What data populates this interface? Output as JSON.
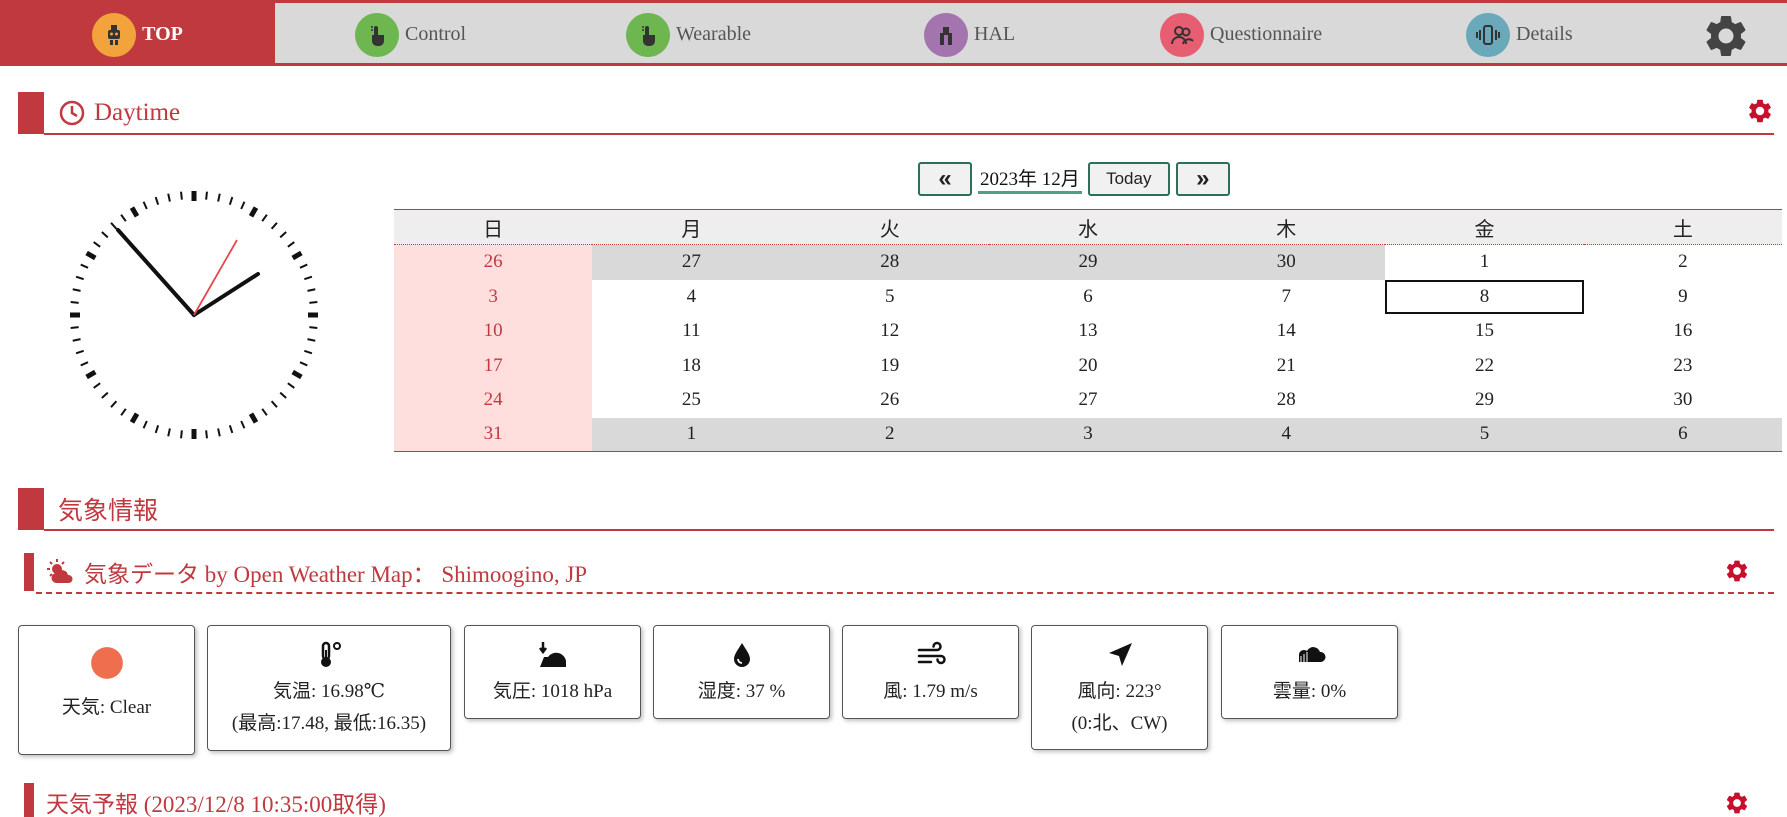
{
  "nav": {
    "tabs": [
      {
        "label": "TOP",
        "icon": "robot-icon",
        "color": "#f3a33c"
      },
      {
        "label": "Control",
        "icon": "touch-hand-icon",
        "color": "#6db650"
      },
      {
        "label": "Wearable",
        "icon": "touch-hand-icon",
        "color": "#6db650"
      },
      {
        "label": "HAL",
        "icon": "hal-icon",
        "color": "#a374ad"
      },
      {
        "label": "Questionnaire",
        "icon": "people-icon",
        "color": "#e75e72"
      },
      {
        "label": "Details",
        "icon": "phone-vibrate-icon",
        "color": "#6aa9b9"
      }
    ],
    "accent": "#c0393f"
  },
  "daytime": {
    "title": "Daytime"
  },
  "calendar": {
    "prev_label": "«",
    "next_label": "»",
    "month_label": "2023年 12月",
    "today_label": "Today",
    "weekdays": [
      "日",
      "月",
      "火",
      "水",
      "木",
      "金",
      "土"
    ],
    "weeks": [
      [
        "26",
        "27",
        "28",
        "29",
        "30",
        "1",
        "2"
      ],
      [
        "3",
        "4",
        "5",
        "6",
        "7",
        "8",
        "9"
      ],
      [
        "10",
        "11",
        "12",
        "13",
        "14",
        "15",
        "16"
      ],
      [
        "17",
        "18",
        "19",
        "20",
        "21",
        "22",
        "23"
      ],
      [
        "24",
        "25",
        "26",
        "27",
        "28",
        "29",
        "30"
      ],
      [
        "31",
        "1",
        "2",
        "3",
        "4",
        "5",
        "6"
      ]
    ],
    "selected_day": "8"
  },
  "weather_section": {
    "title": "気象情報"
  },
  "weather_data": {
    "title": "気象データ by Open Weather Map： Shimoogino, JP",
    "cards": [
      {
        "icon": "sun-dot-icon",
        "lines": [
          "天気: Clear"
        ]
      },
      {
        "icon": "thermometer-icon",
        "lines": [
          "気温: 16.98℃",
          "(最高:17.48, 最低:16.35)"
        ]
      },
      {
        "icon": "pressure-icon",
        "lines": [
          "気圧: 1018 hPa"
        ]
      },
      {
        "icon": "droplet-icon",
        "lines": [
          "湿度: 37 %"
        ]
      },
      {
        "icon": "wind-icon",
        "lines": [
          "風: 1.79 m/s"
        ]
      },
      {
        "icon": "location-arrow-icon",
        "lines": [
          "風向: 223°",
          "(0:北、CW)"
        ]
      },
      {
        "icon": "cloud-icon",
        "lines": [
          "雲量: 0%"
        ]
      }
    ]
  },
  "forecast": {
    "title": "天気予報 (2023/12/8 10:35:00取得)"
  }
}
